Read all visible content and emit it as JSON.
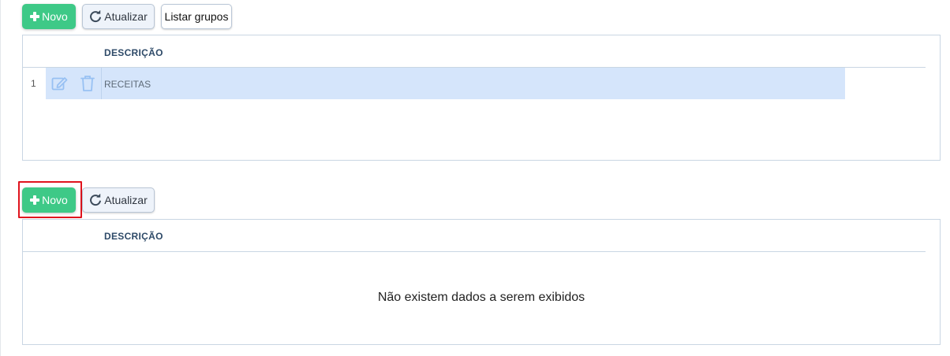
{
  "toolbar1": {
    "new_label": "Novo",
    "refresh_label": "Atualizar",
    "list_groups_label": "Listar grupos"
  },
  "grid1": {
    "column_header": "DESCRIÇÃO",
    "rows": [
      {
        "number": "1",
        "descricao": "RECEITAS"
      }
    ]
  },
  "toolbar2": {
    "new_label": "Novo",
    "refresh_label": "Atualizar"
  },
  "grid2": {
    "column_header": "DESCRIÇÃO",
    "empty_message": "Não existem dados a serem exibidos"
  },
  "colors": {
    "primary_green": "#3ec987",
    "selected_row": "#d5e5fb",
    "highlight_red": "#e0141e",
    "header_text": "#2e4a68"
  }
}
